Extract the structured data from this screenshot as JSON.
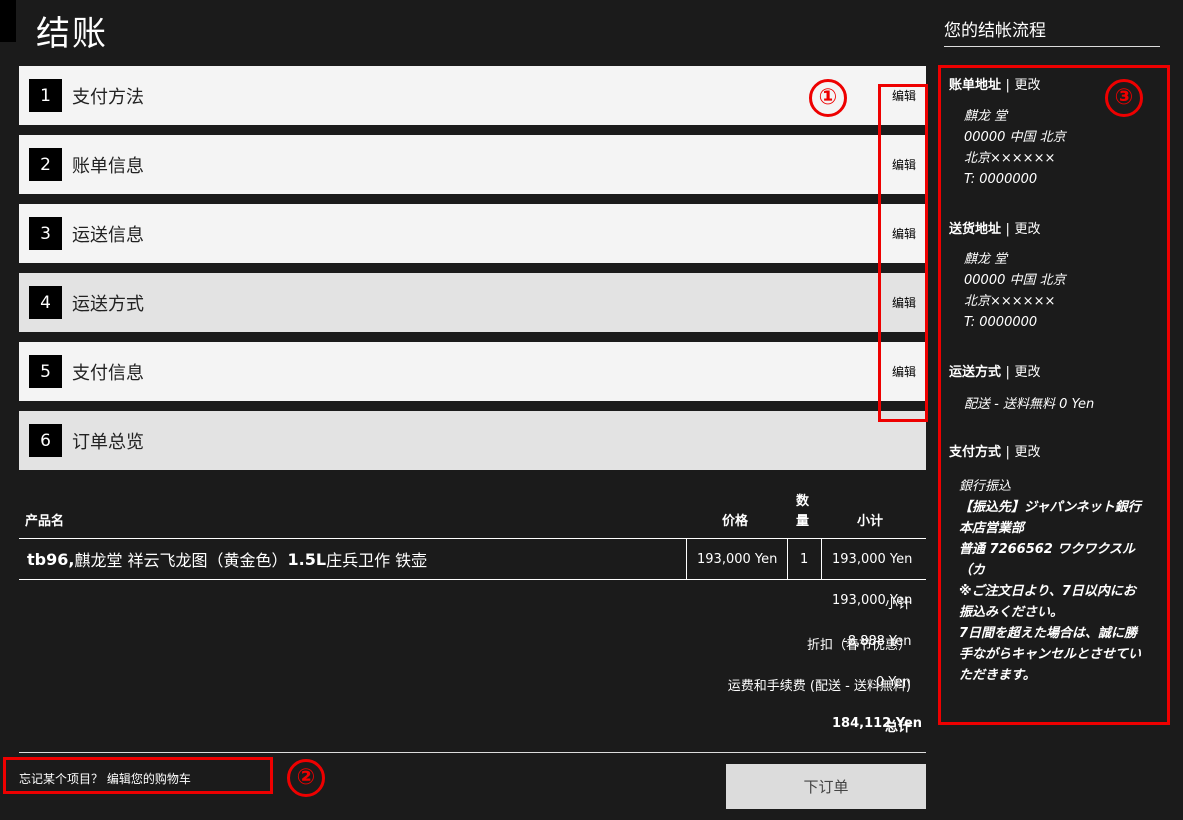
{
  "page": {
    "title": "结账"
  },
  "steps": [
    {
      "num": "1",
      "label": "支付方法",
      "edit": "编辑"
    },
    {
      "num": "2",
      "label": "账单信息",
      "edit": "编辑"
    },
    {
      "num": "3",
      "label": "运送信息",
      "edit": "编辑"
    },
    {
      "num": "4",
      "label": "运送方式",
      "edit": "编辑"
    },
    {
      "num": "5",
      "label": "支付信息",
      "edit": "编辑"
    },
    {
      "num": "6",
      "label": "订单总览",
      "edit": ""
    }
  ],
  "annotations": {
    "one": "①",
    "two": "②",
    "three": "③"
  },
  "table": {
    "headers": {
      "product": "产品名",
      "price": "价格",
      "qty_1": "数",
      "qty_2": "量",
      "subtotal": "小计"
    },
    "rows": [
      {
        "sku": "tb96,",
        "name": " 麒龙堂 祥云飞龙图（黄金色）",
        "size": "1.5L",
        "name_tail": " 庄兵卫作 铁壶",
        "price": "193,000 Yen",
        "qty": "1",
        "subtotal": "193,000 Yen"
      }
    ]
  },
  "summary": {
    "subtotal_label": "小计",
    "subtotal_value": "193,000 Yen",
    "discount_label": "折扣（春节优惠）",
    "discount_value": "-8,888 Yen",
    "shipping_label": "运费和手续费 (配送 - 送料無料)",
    "shipping_value": "0 Yen",
    "total_label": "总计",
    "total_value": "184,112 Yen"
  },
  "footer": {
    "cart_link": "忘记某个项目？ 编辑您的购物车",
    "order_button": "下订单"
  },
  "sidebar": {
    "title": "您的结帐流程",
    "separator": "|",
    "billing": {
      "title": "账单地址",
      "change": "更改",
      "lines": [
        "麒龙 堂",
        "00000 中国 北京",
        "北京××××××",
        "T: 0000000"
      ]
    },
    "shipping": {
      "title": "送货地址",
      "change": "更改",
      "lines": [
        "麒龙 堂",
        "00000 中国 北京",
        "北京××××××",
        "T: 0000000"
      ]
    },
    "method": {
      "title": "运送方式",
      "change": "更改",
      "lines": [
        "配送 - 送料無料 0 Yen"
      ]
    },
    "payment": {
      "title": "支付方式",
      "change": "更改",
      "lines": [
        "銀行振込",
        "【振込先】ジャパンネット銀行",
        "本店営業部",
        "普通 7266562 ワクワクスル",
        "（カ",
        "※ご注文日より、7日以内にお",
        "振込みください。",
        "7日間を超えた場合は、誠に勝",
        "手ながらキャンセルとさせてい",
        "ただきます。"
      ]
    }
  },
  "colors": {
    "background": "#1b1b1b",
    "annotation": "#e00000",
    "step_bg": "#f4f4f4"
  }
}
